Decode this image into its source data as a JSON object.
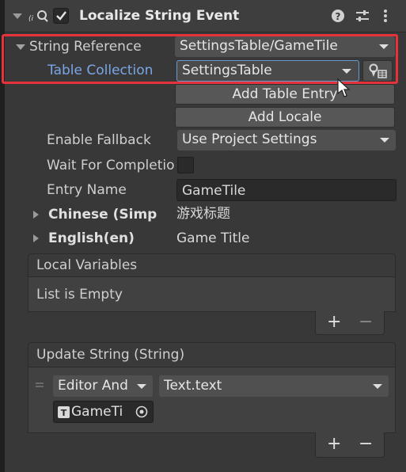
{
  "header": {
    "title": "Localize String Event",
    "enabled": true,
    "icons": [
      "localize-icon",
      "help-icon",
      "settings-sliders-icon",
      "more-vertical-icon"
    ]
  },
  "string_reference": {
    "label": "String Reference",
    "value": "SettingsTable/GameTile"
  },
  "table_collection": {
    "label": "Table Collection",
    "value": "SettingsTable"
  },
  "buttons": {
    "add_table_entry": "Add Table Entry",
    "add_locale": "Add Locale"
  },
  "enable_fallback": {
    "label": "Enable Fallback",
    "value": "Use Project Settings"
  },
  "wait_for_completion": {
    "label": "Wait For Completio",
    "checked": false
  },
  "entry_name": {
    "label": "Entry Name",
    "value": "GameTile"
  },
  "locales": [
    {
      "label": "Chinese (Simp",
      "value": "游戏标题"
    },
    {
      "label": "English(en)",
      "value": "Game Title"
    }
  ],
  "local_variables": {
    "title": "Local Variables",
    "empty_text": "List is Empty",
    "add": "+",
    "remove": "−"
  },
  "update_string": {
    "title": "Update String (String)",
    "runtime_mode": "Editor And",
    "function": "Text.text",
    "target": "GameTi",
    "add": "+",
    "remove": "−"
  },
  "colors": {
    "highlight_border": "#e5323b",
    "table_collection_label": "#7ba6e6",
    "background": "#383838"
  }
}
